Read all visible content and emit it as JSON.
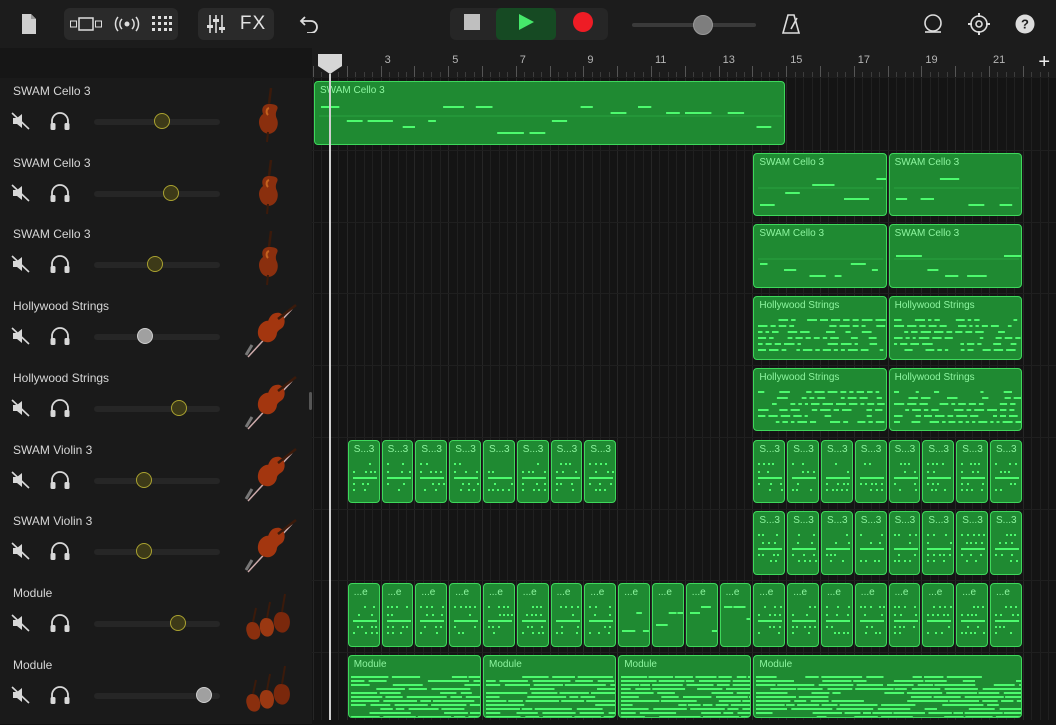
{
  "toolbar": {
    "fx_label": "FX",
    "volume_level": 0.55
  },
  "ruler": {
    "bar_labels": [
      "3",
      "5",
      "7",
      "9",
      "11",
      "13",
      "15",
      "17",
      "19",
      "21"
    ],
    "add_label": "+"
  },
  "tracks": [
    {
      "name": "SWAM Cello 3",
      "volume": 0.58,
      "knob": "olive",
      "instrument": "cello"
    },
    {
      "name": "SWAM Cello 3",
      "volume": 0.65,
      "knob": "olive",
      "instrument": "cello"
    },
    {
      "name": "SWAM Cello 3",
      "volume": 0.52,
      "knob": "olive",
      "instrument": "cello"
    },
    {
      "name": "Hollywood Strings",
      "volume": 0.43,
      "knob": "white",
      "instrument": "violin"
    },
    {
      "name": "Hollywood Strings",
      "volume": 0.72,
      "knob": "olive",
      "instrument": "violin"
    },
    {
      "name": "SWAM Violin 3",
      "volume": 0.42,
      "knob": "olive",
      "instrument": "violin"
    },
    {
      "name": "SWAM Violin 3",
      "volume": 0.42,
      "knob": "olive",
      "instrument": "violin"
    },
    {
      "name": "Module",
      "volume": 0.71,
      "knob": "olive",
      "instrument": "ensemble"
    },
    {
      "name": "Module",
      "volume": 0.93,
      "knob": "white",
      "instrument": "ensemble"
    }
  ],
  "regions": [
    {
      "track": 0,
      "bars": [
        1,
        15
      ],
      "label": "SWAM Cello 3",
      "style": "sparse"
    },
    {
      "track": 1,
      "bars": [
        14,
        18
      ],
      "label": "SWAM Cello 3",
      "style": "sparse"
    },
    {
      "track": 1,
      "bars": [
        18,
        22
      ],
      "label": "SWAM Cello 3",
      "style": "sparse"
    },
    {
      "track": 2,
      "bars": [
        14,
        18
      ],
      "label": "SWAM Cello 3",
      "style": "sparse"
    },
    {
      "track": 2,
      "bars": [
        18,
        22
      ],
      "label": "SWAM Cello 3",
      "style": "sparse"
    },
    {
      "track": 3,
      "bars": [
        14,
        18
      ],
      "label": "Hollywood Strings",
      "style": "dense"
    },
    {
      "track": 3,
      "bars": [
        18,
        22
      ],
      "label": "Hollywood Strings",
      "style": "dense"
    },
    {
      "track": 4,
      "bars": [
        14,
        18
      ],
      "label": "Hollywood Strings",
      "style": "dense"
    },
    {
      "track": 4,
      "bars": [
        18,
        22
      ],
      "label": "Hollywood Strings",
      "style": "dense"
    },
    {
      "track": 5,
      "bars": [
        2,
        3
      ],
      "label": "S...3",
      "style": "dots"
    },
    {
      "track": 5,
      "bars": [
        3,
        4
      ],
      "label": "S...3",
      "style": "dots"
    },
    {
      "track": 5,
      "bars": [
        4,
        5
      ],
      "label": "S...3",
      "style": "dots"
    },
    {
      "track": 5,
      "bars": [
        5,
        6
      ],
      "label": "S...3",
      "style": "dots"
    },
    {
      "track": 5,
      "bars": [
        6,
        7
      ],
      "label": "S...3",
      "style": "dots"
    },
    {
      "track": 5,
      "bars": [
        7,
        8
      ],
      "label": "S...3",
      "style": "dots"
    },
    {
      "track": 5,
      "bars": [
        8,
        9
      ],
      "label": "S...3",
      "style": "dots"
    },
    {
      "track": 5,
      "bars": [
        9,
        10
      ],
      "label": "S...3",
      "style": "dots"
    },
    {
      "track": 5,
      "bars": [
        14,
        15
      ],
      "label": "S...3",
      "style": "dots"
    },
    {
      "track": 5,
      "bars": [
        15,
        16
      ],
      "label": "S...3",
      "style": "dots"
    },
    {
      "track": 5,
      "bars": [
        16,
        17
      ],
      "label": "S...3",
      "style": "dots"
    },
    {
      "track": 5,
      "bars": [
        17,
        18
      ],
      "label": "S...3",
      "style": "dots"
    },
    {
      "track": 5,
      "bars": [
        18,
        19
      ],
      "label": "S...3",
      "style": "dots"
    },
    {
      "track": 5,
      "bars": [
        19,
        20
      ],
      "label": "S...3",
      "style": "dots"
    },
    {
      "track": 5,
      "bars": [
        20,
        21
      ],
      "label": "S...3",
      "style": "dots"
    },
    {
      "track": 5,
      "bars": [
        21,
        22
      ],
      "label": "S...3",
      "style": "dots"
    },
    {
      "track": 6,
      "bars": [
        14,
        15
      ],
      "label": "S...3",
      "style": "dots"
    },
    {
      "track": 6,
      "bars": [
        15,
        16
      ],
      "label": "S...3",
      "style": "dots"
    },
    {
      "track": 6,
      "bars": [
        16,
        17
      ],
      "label": "S...3",
      "style": "dots"
    },
    {
      "track": 6,
      "bars": [
        17,
        18
      ],
      "label": "S...3",
      "style": "dots"
    },
    {
      "track": 6,
      "bars": [
        18,
        19
      ],
      "label": "S...3",
      "style": "dots"
    },
    {
      "track": 6,
      "bars": [
        19,
        20
      ],
      "label": "S...3",
      "style": "dots"
    },
    {
      "track": 6,
      "bars": [
        20,
        21
      ],
      "label": "S...3",
      "style": "dots"
    },
    {
      "track": 6,
      "bars": [
        21,
        22
      ],
      "label": "S...3",
      "style": "dots"
    },
    {
      "track": 7,
      "bars": [
        2,
        3
      ],
      "label": "...e",
      "style": "dots"
    },
    {
      "track": 7,
      "bars": [
        3,
        4
      ],
      "label": "...e",
      "style": "dots"
    },
    {
      "track": 7,
      "bars": [
        4,
        5
      ],
      "label": "...e",
      "style": "dots"
    },
    {
      "track": 7,
      "bars": [
        5,
        6
      ],
      "label": "...e",
      "style": "dots"
    },
    {
      "track": 7,
      "bars": [
        6,
        7
      ],
      "label": "...e",
      "style": "dots"
    },
    {
      "track": 7,
      "bars": [
        7,
        8
      ],
      "label": "...e",
      "style": "dots"
    },
    {
      "track": 7,
      "bars": [
        8,
        9
      ],
      "label": "...e",
      "style": "dots"
    },
    {
      "track": 7,
      "bars": [
        9,
        10
      ],
      "label": "...e",
      "style": "dots"
    },
    {
      "track": 7,
      "bars": [
        10,
        11
      ],
      "label": "...e",
      "style": "steps"
    },
    {
      "track": 7,
      "bars": [
        11,
        12
      ],
      "label": "...e",
      "style": "steps"
    },
    {
      "track": 7,
      "bars": [
        12,
        13
      ],
      "label": "...e",
      "style": "steps"
    },
    {
      "track": 7,
      "bars": [
        13,
        14
      ],
      "label": "...e",
      "style": "steps"
    },
    {
      "track": 7,
      "bars": [
        14,
        15
      ],
      "label": "...e",
      "style": "dots"
    },
    {
      "track": 7,
      "bars": [
        15,
        16
      ],
      "label": "...e",
      "style": "dots"
    },
    {
      "track": 7,
      "bars": [
        16,
        17
      ],
      "label": "...e",
      "style": "dots"
    },
    {
      "track": 7,
      "bars": [
        17,
        18
      ],
      "label": "...e",
      "style": "dots"
    },
    {
      "track": 7,
      "bars": [
        18,
        19
      ],
      "label": "...e",
      "style": "dots"
    },
    {
      "track": 7,
      "bars": [
        19,
        20
      ],
      "label": "...e",
      "style": "dots"
    },
    {
      "track": 7,
      "bars": [
        20,
        21
      ],
      "label": "...e",
      "style": "dots"
    },
    {
      "track": 7,
      "bars": [
        21,
        22
      ],
      "label": "...e",
      "style": "dots"
    },
    {
      "track": 8,
      "bars": [
        2,
        6
      ],
      "label": "Module",
      "style": "bars"
    },
    {
      "track": 8,
      "bars": [
        6,
        10
      ],
      "label": "Module",
      "style": "bars"
    },
    {
      "track": 8,
      "bars": [
        10,
        14
      ],
      "label": "Module",
      "style": "bars"
    },
    {
      "track": 8,
      "bars": [
        14,
        22
      ],
      "label": "Module",
      "style": "bars"
    }
  ]
}
